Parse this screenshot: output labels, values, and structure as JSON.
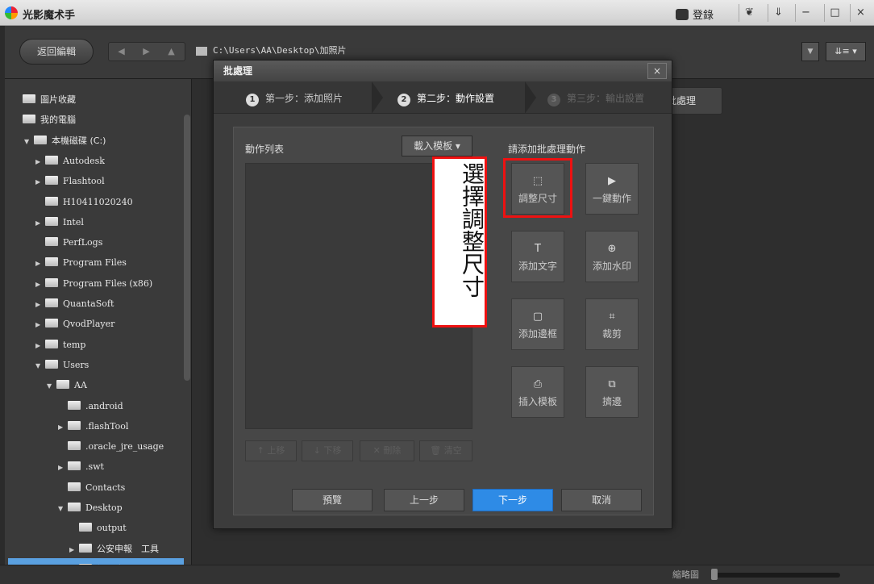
{
  "app": {
    "title": "光影魔术手",
    "login_label": "登錄"
  },
  "window_controls": [
    "❦",
    "⇓",
    "−",
    "□",
    "×"
  ],
  "toolbar": {
    "back_edit": "返回編輯",
    "nav": [
      "◀",
      "▶",
      "▲"
    ],
    "path": "C:\\Users\\AA\\Desktop\\加照片",
    "sort_label": "⇊≡ ▾"
  },
  "tree": [
    {
      "label": "圖片收藏",
      "depth": 0,
      "caret": ""
    },
    {
      "label": "我的電腦",
      "depth": 0,
      "caret": ""
    },
    {
      "label": "本機磁碟 (C:)",
      "depth": 1,
      "caret": "▼"
    },
    {
      "label": "Autodesk",
      "depth": 2,
      "caret": "▶"
    },
    {
      "label": "Flashtool",
      "depth": 2,
      "caret": "▶"
    },
    {
      "label": "H10411020240",
      "depth": 2,
      "caret": ""
    },
    {
      "label": "Intel",
      "depth": 2,
      "caret": "▶"
    },
    {
      "label": "PerfLogs",
      "depth": 2,
      "caret": ""
    },
    {
      "label": "Program Files",
      "depth": 2,
      "caret": "▶"
    },
    {
      "label": "Program Files (x86)",
      "depth": 2,
      "caret": "▶"
    },
    {
      "label": "QuantaSoft",
      "depth": 2,
      "caret": "▶"
    },
    {
      "label": "QvodPlayer",
      "depth": 2,
      "caret": "▶"
    },
    {
      "label": "temp",
      "depth": 2,
      "caret": "▶"
    },
    {
      "label": "Users",
      "depth": 2,
      "caret": "▼"
    },
    {
      "label": "AA",
      "depth": 3,
      "caret": "▼"
    },
    {
      "label": ".android",
      "depth": 4,
      "caret": ""
    },
    {
      "label": ".flashTool",
      "depth": 4,
      "caret": "▶"
    },
    {
      "label": ".oracle_jre_usage",
      "depth": 4,
      "caret": ""
    },
    {
      "label": ".swt",
      "depth": 4,
      "caret": "▶"
    },
    {
      "label": "Contacts",
      "depth": 4,
      "caret": ""
    },
    {
      "label": "Desktop",
      "depth": 4,
      "caret": "▼"
    },
    {
      "label": "output",
      "depth": 5,
      "caret": ""
    },
    {
      "label": "公安申報　工具",
      "depth": 5,
      "caret": "▶"
    },
    {
      "label": "加照片",
      "depth": 5,
      "caret": ""
    }
  ],
  "content": {
    "batch_tab": "批處理"
  },
  "status": {
    "zoom_label": "縮略圖"
  },
  "dialog": {
    "title": "批處理",
    "close": "×",
    "steps": [
      {
        "num": "1",
        "label": "第一步：添加照片"
      },
      {
        "num": "2",
        "label": "第二步：動作設置"
      },
      {
        "num": "3",
        "label": "第三步：輸出設置"
      }
    ],
    "list_label": "動作列表",
    "template_btn": "載入模板 ▾",
    "add_label": "請添加批處理動作",
    "list_buttons": [
      "↑ 上移",
      "↓ 下移",
      "✕ 刪除",
      "🗑 清空"
    ],
    "actions": [
      {
        "label": "調整尺寸",
        "icon": "⬚"
      },
      {
        "label": "一鍵動作",
        "icon": "▶"
      },
      {
        "label": "添加文字",
        "icon": "T"
      },
      {
        "label": "添加水印",
        "icon": "⊕"
      },
      {
        "label": "添加邊框",
        "icon": "▢"
      },
      {
        "label": "裁剪",
        "icon": "⌗"
      },
      {
        "label": "插入模板",
        "icon": "⎙"
      },
      {
        "label": "擠邊",
        "icon": "⧉"
      }
    ],
    "footer": {
      "preview": "預覽",
      "prev": "上一步",
      "next": "下一步",
      "cancel": "取消"
    }
  },
  "annotation": {
    "text": "選擇調整尺寸"
  }
}
